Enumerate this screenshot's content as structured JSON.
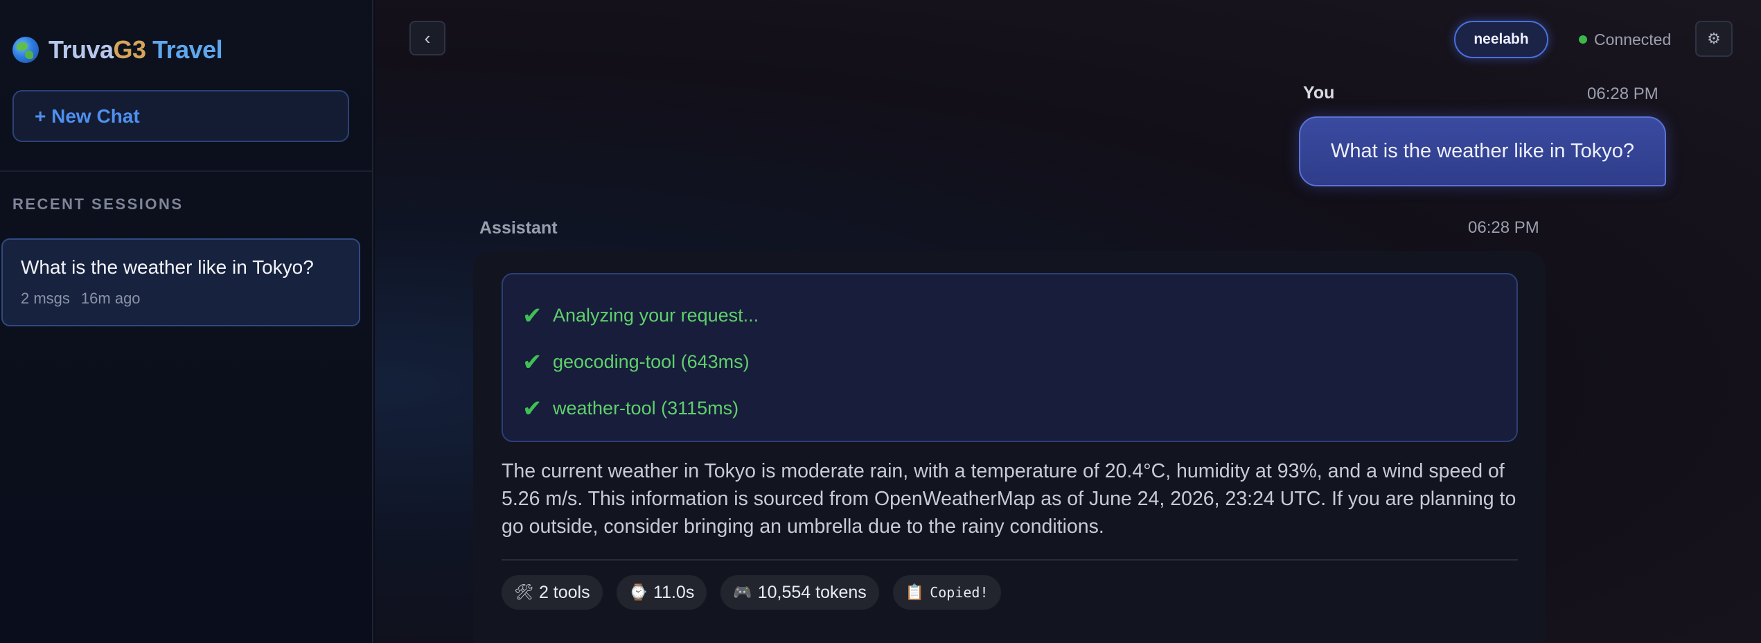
{
  "sidebar": {
    "brand": {
      "part1": "Truva",
      "part2": "G3",
      "part3": " Travel",
      "icon": "globe-icon"
    },
    "new_chat_label": "+ New Chat",
    "recent_label": "RECENT SESSIONS",
    "sessions": [
      {
        "title": "What is the weather like in Tokyo?",
        "msgs": "2 msgs",
        "ago": "16m ago"
      }
    ]
  },
  "header": {
    "collapse_icon": "chevron-left-icon",
    "collapse_glyph": "‹",
    "user": "neelabh",
    "status": "Connected",
    "status_color": "#3cb84a",
    "settings_icon": "gear-icon",
    "settings_glyph": "⚙"
  },
  "messages": {
    "user": {
      "label": "You",
      "time": "06:28 PM",
      "text": "What is the weather like in Tokyo?"
    },
    "assistant": {
      "label": "Assistant",
      "time": "06:28 PM",
      "steps": [
        {
          "text": "Analyzing your request..."
        },
        {
          "text": "geocoding-tool (643ms)"
        },
        {
          "text": "weather-tool (3115ms)"
        }
      ],
      "answer": "The current weather in Tokyo is moderate rain, with a temperature of 20.4°C, humidity at 93%, and a wind speed of 5.26 m/s. This information is sourced from OpenWeatherMap as of June 24, 2026, 23:24 UTC. If you are planning to go outside, consider bringing an umbrella due to the rainy conditions.",
      "chips": {
        "tools": {
          "icon": "🛠",
          "text": "2 tools"
        },
        "time": {
          "icon": "⌚",
          "text": "11.0s"
        },
        "tokens": {
          "icon": "🎮",
          "text": "10,554 tokens"
        },
        "copy": {
          "icon": "📋",
          "text": "Copied!"
        }
      }
    }
  },
  "colors": {
    "accent": "#4f8ff0",
    "step_green": "#5fd06c",
    "bubble": "#3a4aa0"
  }
}
